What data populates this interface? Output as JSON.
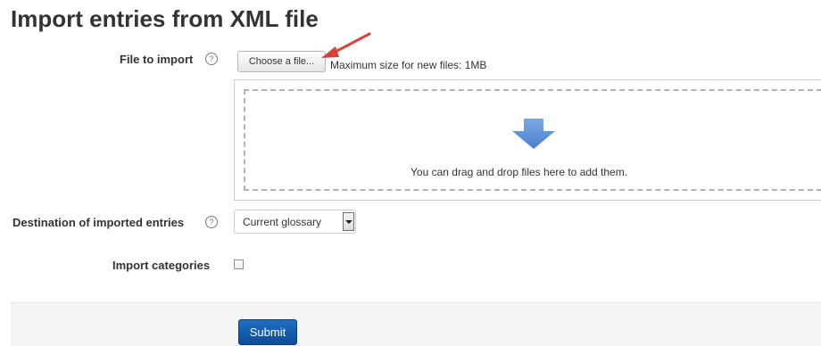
{
  "page": {
    "title": "Import entries from XML file"
  },
  "file_field": {
    "label": "File to import",
    "help_icon": "question-circle-icon",
    "choose_button_label": "Choose a file...",
    "max_size_text": "Maximum size for new files: 1MB",
    "annotation_icon": "red-arrow-icon",
    "annotation_color": "#d9413c"
  },
  "dropzone": {
    "icon": "down-arrow-icon",
    "icon_color": "#5b8fd9",
    "text": "You can drag and drop files here to add them."
  },
  "destination_field": {
    "label": "Destination of imported entries",
    "help_icon": "question-circle-icon",
    "selected_option": "Current glossary"
  },
  "categories_field": {
    "label": "Import categories",
    "checked": false
  },
  "form_actions": {
    "submit_label": "Submit",
    "submit_color": "#0f5aa8"
  },
  "glyphs": {
    "help": "?"
  }
}
